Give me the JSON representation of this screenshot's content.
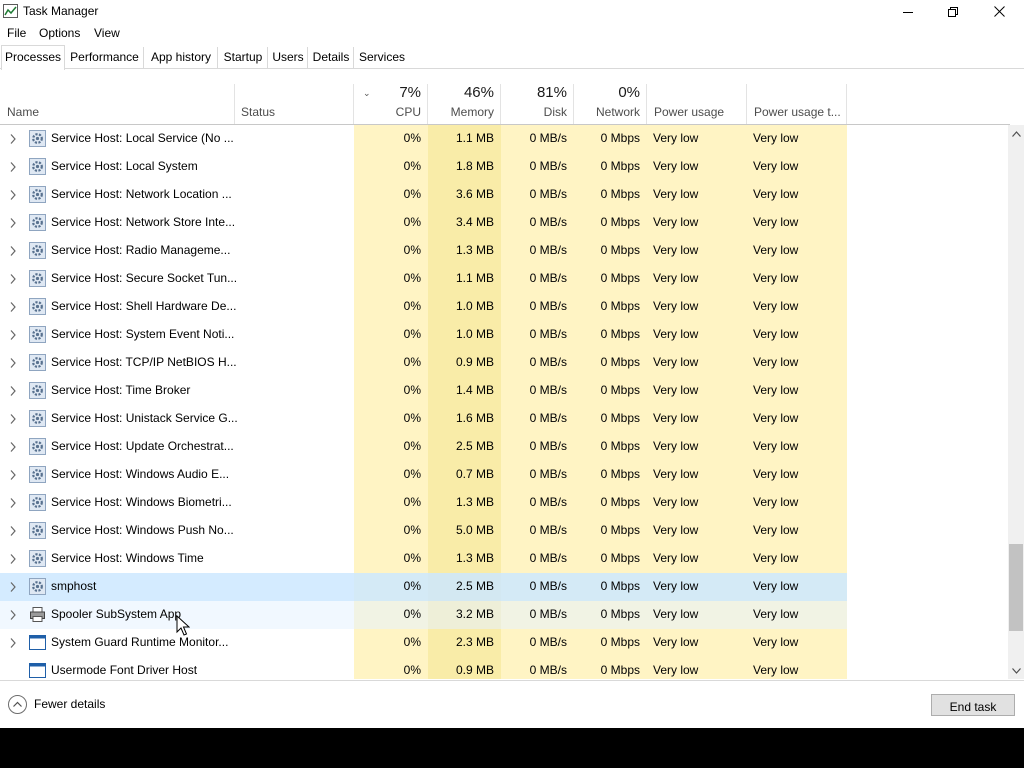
{
  "window": {
    "title": "Task Manager"
  },
  "menu": [
    "File",
    "Options",
    "View"
  ],
  "tabs": [
    "Processes",
    "Performance",
    "App history",
    "Startup",
    "Users",
    "Details",
    "Services"
  ],
  "active_tab": "Processes",
  "columns": {
    "name": {
      "label": "Name"
    },
    "status": {
      "label": "Status"
    },
    "cpu": {
      "label": "CPU",
      "pct": "7%"
    },
    "memory": {
      "label": "Memory",
      "pct": "46%"
    },
    "disk": {
      "label": "Disk",
      "pct": "81%"
    },
    "network": {
      "label": "Network",
      "pct": "0%"
    },
    "power": {
      "label": "Power usage"
    },
    "power_trend": {
      "label": "Power usage t..."
    }
  },
  "rows": [
    {
      "name": "Service Host: Local Service (No ...",
      "cpu": "0%",
      "memory": "1.1 MB",
      "disk": "0 MB/s",
      "network": "0 Mbps",
      "power": "Very low",
      "power_trend": "Very low",
      "icon": "gear-icon",
      "expandable": true,
      "highlight": ""
    },
    {
      "name": "Service Host: Local System",
      "cpu": "0%",
      "memory": "1.8 MB",
      "disk": "0 MB/s",
      "network": "0 Mbps",
      "power": "Very low",
      "power_trend": "Very low",
      "icon": "gear-icon",
      "expandable": true,
      "highlight": ""
    },
    {
      "name": "Service Host: Network Location ...",
      "cpu": "0%",
      "memory": "3.6 MB",
      "disk": "0 MB/s",
      "network": "0 Mbps",
      "power": "Very low",
      "power_trend": "Very low",
      "icon": "gear-icon",
      "expandable": true,
      "highlight": ""
    },
    {
      "name": "Service Host: Network Store Inte...",
      "cpu": "0%",
      "memory": "3.4 MB",
      "disk": "0 MB/s",
      "network": "0 Mbps",
      "power": "Very low",
      "power_trend": "Very low",
      "icon": "gear-icon",
      "expandable": true,
      "highlight": ""
    },
    {
      "name": "Service Host: Radio Manageme...",
      "cpu": "0%",
      "memory": "1.3 MB",
      "disk": "0 MB/s",
      "network": "0 Mbps",
      "power": "Very low",
      "power_trend": "Very low",
      "icon": "gear-icon",
      "expandable": true,
      "highlight": ""
    },
    {
      "name": "Service Host: Secure Socket Tun...",
      "cpu": "0%",
      "memory": "1.1 MB",
      "disk": "0 MB/s",
      "network": "0 Mbps",
      "power": "Very low",
      "power_trend": "Very low",
      "icon": "gear-icon",
      "expandable": true,
      "highlight": ""
    },
    {
      "name": "Service Host: Shell Hardware De...",
      "cpu": "0%",
      "memory": "1.0 MB",
      "disk": "0 MB/s",
      "network": "0 Mbps",
      "power": "Very low",
      "power_trend": "Very low",
      "icon": "gear-icon",
      "expandable": true,
      "highlight": ""
    },
    {
      "name": "Service Host: System Event Noti...",
      "cpu": "0%",
      "memory": "1.0 MB",
      "disk": "0 MB/s",
      "network": "0 Mbps",
      "power": "Very low",
      "power_trend": "Very low",
      "icon": "gear-icon",
      "expandable": true,
      "highlight": ""
    },
    {
      "name": "Service Host: TCP/IP NetBIOS H...",
      "cpu": "0%",
      "memory": "0.9 MB",
      "disk": "0 MB/s",
      "network": "0 Mbps",
      "power": "Very low",
      "power_trend": "Very low",
      "icon": "gear-icon",
      "expandable": true,
      "highlight": ""
    },
    {
      "name": "Service Host: Time Broker",
      "cpu": "0%",
      "memory": "1.4 MB",
      "disk": "0 MB/s",
      "network": "0 Mbps",
      "power": "Very low",
      "power_trend": "Very low",
      "icon": "gear-icon",
      "expandable": true,
      "highlight": ""
    },
    {
      "name": "Service Host: Unistack Service G...",
      "cpu": "0%",
      "memory": "1.6 MB",
      "disk": "0 MB/s",
      "network": "0 Mbps",
      "power": "Very low",
      "power_trend": "Very low",
      "icon": "gear-icon",
      "expandable": true,
      "highlight": ""
    },
    {
      "name": "Service Host: Update Orchestrat...",
      "cpu": "0%",
      "memory": "2.5 MB",
      "disk": "0 MB/s",
      "network": "0 Mbps",
      "power": "Very low",
      "power_trend": "Very low",
      "icon": "gear-icon",
      "expandable": true,
      "highlight": ""
    },
    {
      "name": "Service Host: Windows Audio E...",
      "cpu": "0%",
      "memory": "0.7 MB",
      "disk": "0 MB/s",
      "network": "0 Mbps",
      "power": "Very low",
      "power_trend": "Very low",
      "icon": "gear-icon",
      "expandable": true,
      "highlight": ""
    },
    {
      "name": "Service Host: Windows Biometri...",
      "cpu": "0%",
      "memory": "1.3 MB",
      "disk": "0 MB/s",
      "network": "0 Mbps",
      "power": "Very low",
      "power_trend": "Very low",
      "icon": "gear-icon",
      "expandable": true,
      "highlight": ""
    },
    {
      "name": "Service Host: Windows Push No...",
      "cpu": "0%",
      "memory": "5.0 MB",
      "disk": "0 MB/s",
      "network": "0 Mbps",
      "power": "Very low",
      "power_trend": "Very low",
      "icon": "gear-icon",
      "expandable": true,
      "highlight": ""
    },
    {
      "name": "Service Host: Windows Time",
      "cpu": "0%",
      "memory": "1.3 MB",
      "disk": "0 MB/s",
      "network": "0 Mbps",
      "power": "Very low",
      "power_trend": "Very low",
      "icon": "gear-icon",
      "expandable": true,
      "highlight": ""
    },
    {
      "name": "smphost",
      "cpu": "0%",
      "memory": "2.5 MB",
      "disk": "0 MB/s",
      "network": "0 Mbps",
      "power": "Very low",
      "power_trend": "Very low",
      "icon": "gear-icon",
      "expandable": true,
      "highlight": "selected"
    },
    {
      "name": "Spooler SubSystem App",
      "cpu": "0%",
      "memory": "3.2 MB",
      "disk": "0 MB/s",
      "network": "0 Mbps",
      "power": "Very low",
      "power_trend": "Very low",
      "icon": "printer-icon",
      "expandable": true,
      "highlight": "hover"
    },
    {
      "name": "System Guard Runtime Monitor...",
      "cpu": "0%",
      "memory": "2.3 MB",
      "disk": "0 MB/s",
      "network": "0 Mbps",
      "power": "Very low",
      "power_trend": "Very low",
      "icon": "app-window-icon",
      "expandable": true,
      "highlight": ""
    },
    {
      "name": "Usermode Font Driver Host",
      "cpu": "0%",
      "memory": "0.9 MB",
      "disk": "0 MB/s",
      "network": "0 Mbps",
      "power": "Very low",
      "power_trend": "Very low",
      "icon": "app-window-icon",
      "expandable": false,
      "highlight": ""
    }
  ],
  "footer": {
    "fewer_details": "Fewer details",
    "end_task": "End task"
  },
  "colors": {
    "heat_low": "#fff4c4",
    "heat_mid": "#f9eca8",
    "selected_row": "#cce8ff",
    "hover_row": "#e5f3ff"
  }
}
